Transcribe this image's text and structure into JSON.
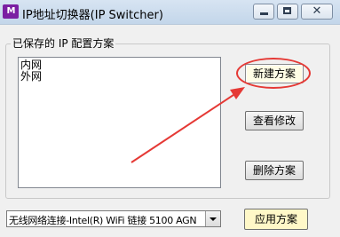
{
  "window": {
    "title": "IP地址切换器(IP Switcher)",
    "app_icon_text": "M",
    "close_glyph": "✕"
  },
  "group": {
    "label": "已保存的 IP 配置方案",
    "items": [
      {
        "label": "内网"
      },
      {
        "label": "外网"
      }
    ]
  },
  "buttons": {
    "new_scheme": "新建方案",
    "edit_scheme": "查看修改",
    "delete_scheme": "删除方案",
    "apply_scheme": "应用方案"
  },
  "adapter_select": {
    "value": "无线网络连接-Intel(R) WiFi 链接 5100 AGN"
  },
  "annotation": {
    "color": "#e53935"
  }
}
